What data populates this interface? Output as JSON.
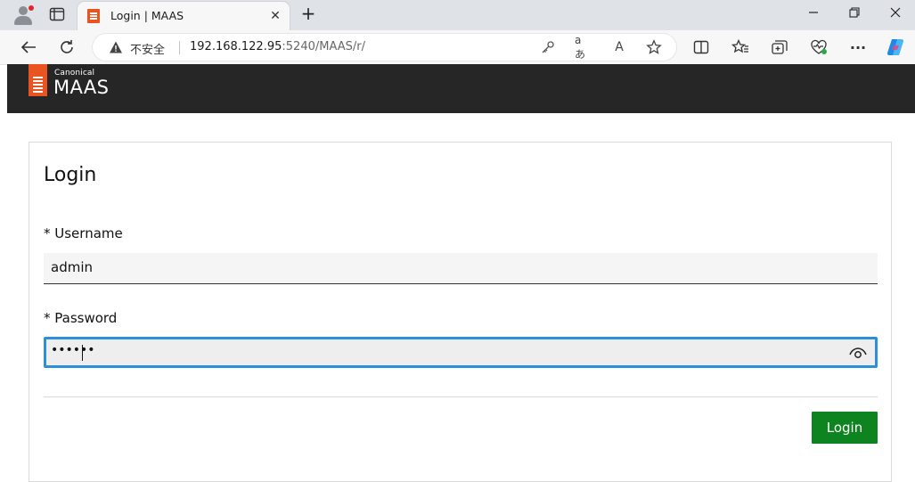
{
  "browser": {
    "tab_title": "Login | MAAS",
    "tab_close": "✕",
    "new_tab": "+",
    "security_label": "不安全",
    "url_host": "192.168.122.95",
    "url_rest": ":5240/MAAS/r/",
    "translate_label": "aあ",
    "read_aloud_label": "A",
    "menu_label": "···"
  },
  "header": {
    "brand_small": "Canonical",
    "brand_name": "MAAS"
  },
  "login": {
    "title": "Login",
    "username_label": "* Username",
    "username_value": "admin",
    "password_label": "* Password",
    "password_masked": "••••••",
    "submit_label": "Login"
  },
  "colors": {
    "brand": "#e95420",
    "navbar": "#262626",
    "submit": "#0e8420",
    "focus": "#2b90d9"
  }
}
